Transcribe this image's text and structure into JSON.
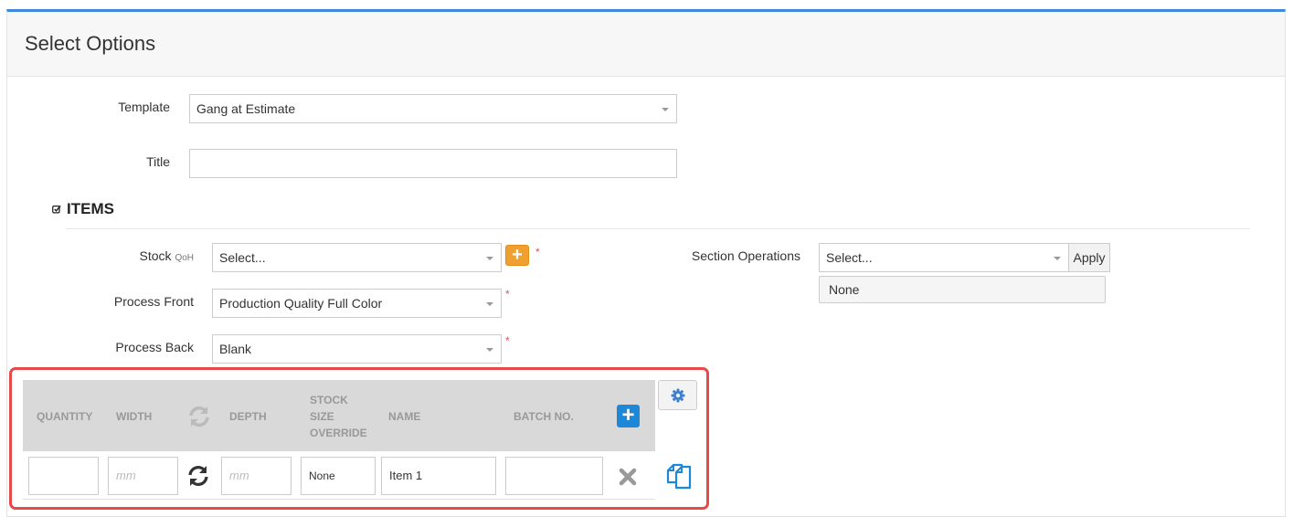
{
  "header": {
    "title": "Select Options"
  },
  "form": {
    "template": {
      "label": "Template",
      "value": "Gang at Estimate"
    },
    "title": {
      "label": "Title",
      "value": ""
    }
  },
  "items_section": {
    "title": "ITEMS"
  },
  "stock": {
    "label": "Stock",
    "sublabel": "QoH",
    "value": "Select...",
    "required_mark": "*"
  },
  "process_front": {
    "label": "Process Front",
    "value": "Production Quality Full Color",
    "required_mark": "*"
  },
  "process_back": {
    "label": "Process Back",
    "value": "Blank",
    "required_mark": "*"
  },
  "section_operations": {
    "label": "Section Operations",
    "value": "Select...",
    "apply_label": "Apply",
    "dropdown_option": "None"
  },
  "table": {
    "headers": {
      "quantity": "QUANTITY",
      "width": "WIDTH",
      "depth": "DEPTH",
      "stock_size_override": [
        "STOCK",
        "SIZE",
        "OVERRIDE"
      ],
      "name": "NAME",
      "batch_no": "BATCH NO."
    },
    "row": {
      "quantity": "",
      "width_placeholder": "mm",
      "depth_placeholder": "mm",
      "stock_size_override": "None",
      "name": "Item 1",
      "batch_no": ""
    }
  },
  "colors": {
    "accent": "#3c8ade",
    "highlight": "#e84848",
    "add_orange": "#f0a030",
    "add_blue": "#1e88d8"
  }
}
